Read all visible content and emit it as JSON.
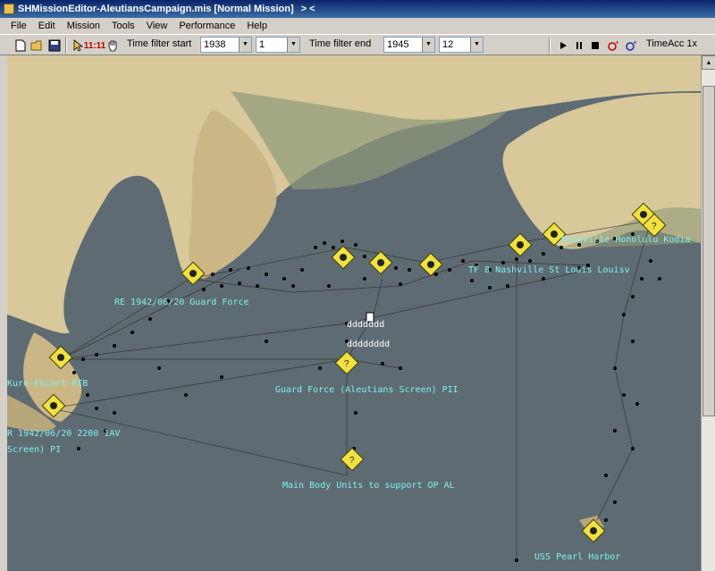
{
  "window": {
    "title": "SHMissionEditor-AleutiansCampaign.mis [Normal Mission]",
    "title_extra": "> <"
  },
  "menu": {
    "items": [
      "File",
      "Edit",
      "Mission",
      "Tools",
      "View",
      "Performance",
      "Help"
    ]
  },
  "toolbar": {
    "clock_label": "11:11",
    "time_filter_start_label": "Time filter start",
    "start_year": "1938",
    "start_month": "1",
    "time_filter_end_label": "Time filter end",
    "end_year": "1945",
    "end_month": "12",
    "time_acc_label": "TimeAcc 1x",
    "icons": [
      "new-icon",
      "open-icon",
      "save-icon",
      "pointer-icon",
      "clock-icon",
      "hand-icon",
      "play-icon",
      "pause-icon",
      "stop-icon",
      "add-unit-icon",
      "add-group-icon"
    ]
  },
  "map": {
    "labels": {
      "guard_force": "Guard Force (Aleutians Screen)  PII",
      "main_body": "Main Body Units to support OP AL",
      "ddd1": "ddddddd",
      "ddd2": "dddddddd",
      "re": "RE 1942/06/20 Guard Force",
      "rtb": "Kure-Escort-RTB",
      "date_1av": "R  1942/06/20 2200 1AV",
      "screen_pi": "Screen) PI",
      "nashville": "TF 8 Nashville St Louis Louisv",
      "nashville2": "Nashville Honolulu Kodia",
      "uss": "USS Pearl Harbor",
      "tf8": "TF8 Nashville"
    },
    "colors": {
      "ocean": "#5e6b72",
      "land": "#d8c89a",
      "label": "#7ff0f0",
      "marker": "#f0e040"
    }
  }
}
